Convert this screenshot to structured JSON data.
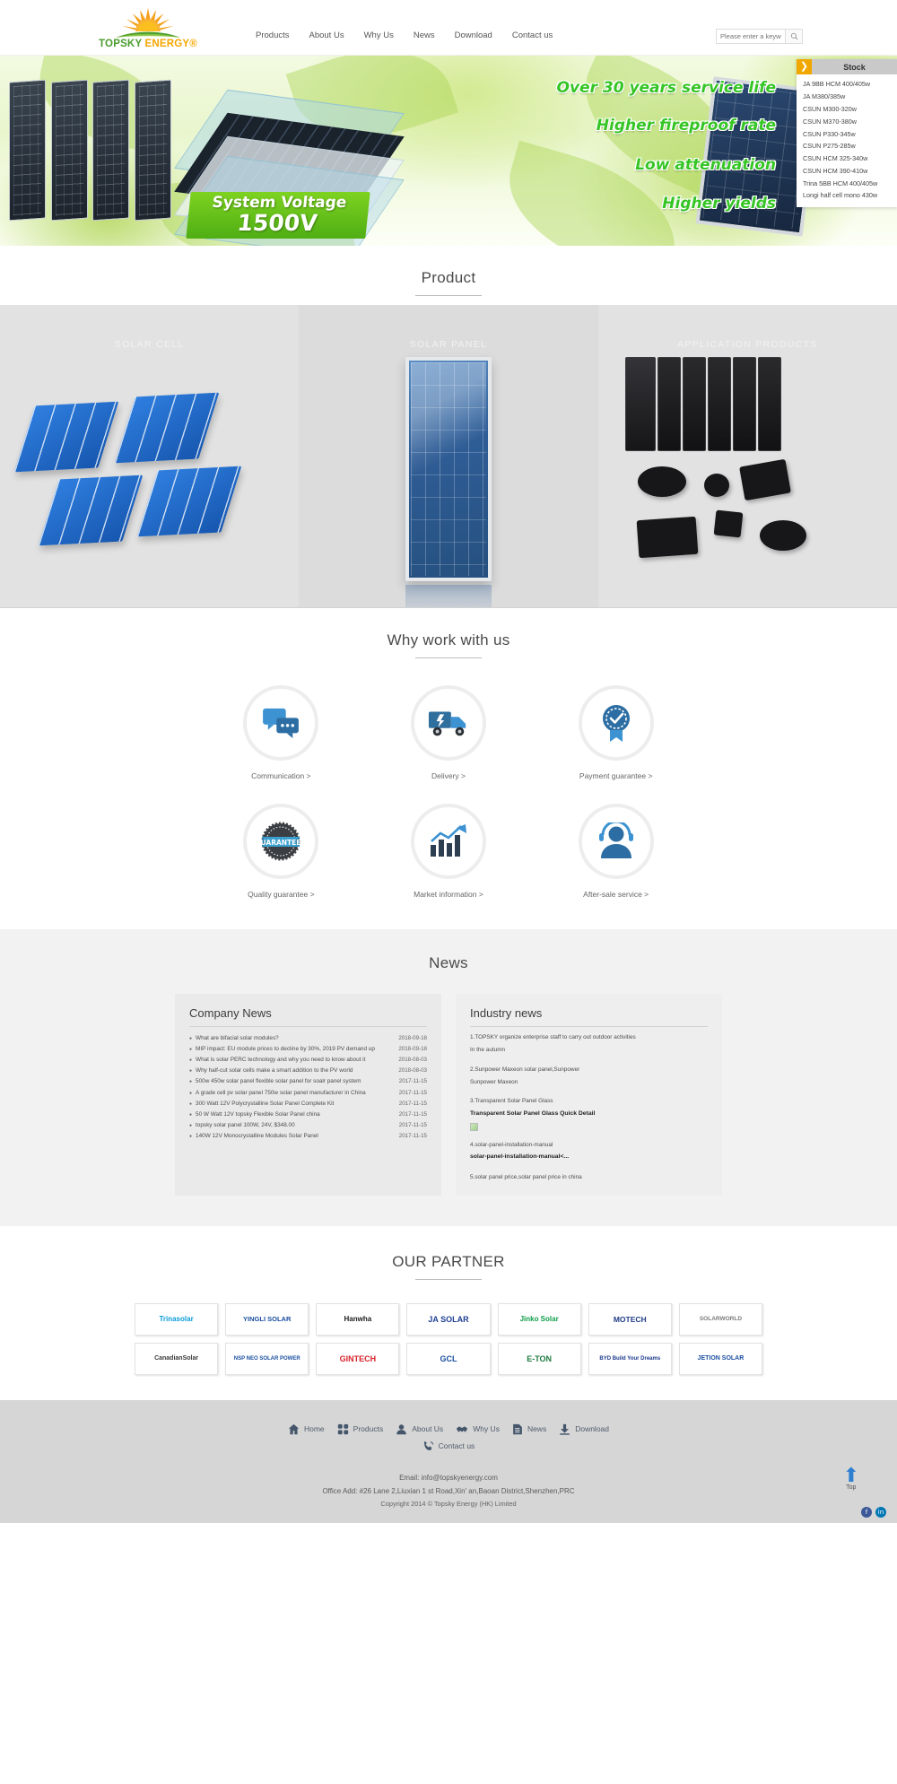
{
  "header": {
    "logo": {
      "name": "TOPSKY ENERGY®",
      "part1": "TOPSKY ",
      "part2": "ENERGY®"
    },
    "nav": [
      {
        "label": "Products"
      },
      {
        "label": "About Us"
      },
      {
        "label": "Why Us"
      },
      {
        "label": "News"
      },
      {
        "label": "Download"
      },
      {
        "label": "Contact us"
      }
    ],
    "search": {
      "placeholder": "Please enter a keyword",
      "value": "",
      "icon": "search-icon"
    }
  },
  "banner": {
    "lines": [
      "Over 30 years service life",
      "Higher fireproof rate",
      "Low attenuation",
      "Higher yields"
    ],
    "badge_line1": "System Voltage",
    "badge_line2": "1500V",
    "stock": {
      "arrow": "❯",
      "title": "Stock",
      "items": [
        "JA 9BB HCM 400/405w",
        "JA M380/385w",
        "CSUN M300-320w",
        "CSUN M370-380w",
        "CSUN P330-345w",
        "CSUN P275-285w",
        "CSUN HCM 325-340w",
        "CSUN HCM 390-410w",
        "Trina 5BB HCM 400/405w",
        "Longi half cell mono 430w"
      ]
    }
  },
  "product_section": {
    "title": "Product",
    "items": [
      {
        "label": "SOLAR CELL"
      },
      {
        "label": "SOLAR PANEL"
      },
      {
        "label": "APPLICATION PRODUCTS"
      }
    ]
  },
  "why_section": {
    "title": "Why work with us",
    "items": [
      {
        "label": "Communication >",
        "icon": "chat-bubbles-icon"
      },
      {
        "label": "Delivery >",
        "icon": "delivery-truck-icon"
      },
      {
        "label": "Payment guarantee >",
        "icon": "shield-check-badge-icon"
      },
      {
        "label": "Quality guarantee >",
        "icon": "guaranteed-seal-icon"
      },
      {
        "label": "Market information >",
        "icon": "bar-chart-arrow-icon"
      },
      {
        "label": "After-sale service >",
        "icon": "person-support-icon"
      }
    ]
  },
  "news_section": {
    "title": "News",
    "company": {
      "heading": "Company News",
      "items": [
        {
          "title": "What are bifacial solar modules?",
          "date": "2018-09-18"
        },
        {
          "title": "MIP impact: EU module prices to decline by 30%, 2019 PV demand up",
          "date": "2018-09-18"
        },
        {
          "title": "What is solar PERC technology and why you need to know about it",
          "date": "2018-08-03"
        },
        {
          "title": "Why half-cut solar cells make a smart addition to the PV world",
          "date": "2018-08-03"
        },
        {
          "title": "500w 450w solar panel flexible solar panel for soalr panel system",
          "date": "2017-11-15"
        },
        {
          "title": "A grade cell pv solar panel 750w solar panel manufacturer in China",
          "date": "2017-11-15"
        },
        {
          "title": "300 Watt 12V Polycrystalline Solar Panel Complete Kit",
          "date": "2017-11-15"
        },
        {
          "title": "50 W Watt 12V topsky Flexible Solar Panel china",
          "date": "2017-11-15"
        },
        {
          "title": "topsky solar panel 100W, 24V,  $348.00",
          "date": "2017-11-15"
        },
        {
          "title": "140W 12V Monocrystalline Modules Solar Panel",
          "date": "2017-11-15"
        }
      ]
    },
    "industry": {
      "heading": "Industry news",
      "lines": [
        "1.TOPSKY organize enterprise staff to carry out outdoor activities",
        "In the autumn",
        "2.Sunpower Maxeon solar panel,Sunpower",
        "Sunpower Maxeon",
        "3.Transparent Solar Panel Glass",
        "Transparent Solar Panel Glass Quick Detail",
        "4.solar-panel-installation-manual",
        "solar-panel-installation-manual<...",
        "5.solar panel price,solar panel price in china"
      ]
    }
  },
  "partners_section": {
    "title": "OUR PARTNER",
    "items": [
      {
        "name": "Trinasolar"
      },
      {
        "name": "YINGLI SOLAR"
      },
      {
        "name": "Hanwha"
      },
      {
        "name": "JA SOLAR"
      },
      {
        "name": "Jinko Solar"
      },
      {
        "name": "MOTECH"
      },
      {
        "name": "SOLARWORLD"
      },
      {
        "name": "CanadianSolar"
      },
      {
        "name": "NSP NEO SOLAR POWER"
      },
      {
        "name": "GINTECH"
      },
      {
        "name": "GCL"
      },
      {
        "name": "E-TON"
      },
      {
        "name": "BYD Build Your Dreams"
      },
      {
        "name": "JETION SOLAR"
      }
    ]
  },
  "footer": {
    "links": [
      {
        "label": "Home",
        "icon": "home-icon"
      },
      {
        "label": "Products",
        "icon": "grid-squares-icon"
      },
      {
        "label": "About Us",
        "icon": "person-icon"
      },
      {
        "label": "Why Us",
        "icon": "handshake-icon"
      },
      {
        "label": "News",
        "icon": "document-icon"
      },
      {
        "label": "Download",
        "icon": "download-icon"
      },
      {
        "label": "Contact us",
        "icon": "phone-icon"
      }
    ],
    "email": "Email: info@topskyenergy.com",
    "address": "Office Add: #26 Lane 2,Liuxian 1 st Road,Xin' an,Baoan District,Shenzhen,PRC",
    "copyright": "Copyright 2014 © Topsky Energy (HK) Limited",
    "to_top": {
      "label": "Top",
      "icon": "up-arrow-icon"
    },
    "social": [
      {
        "name": "facebook-icon",
        "glyph": "f"
      },
      {
        "name": "linkedin-icon",
        "glyph": "in"
      }
    ]
  },
  "colors": {
    "brand_orange": "#f7a600",
    "brand_green": "#4a9c2d",
    "banner_green_text": "#35c524",
    "accent_blue": "#2f7fd1",
    "stock_header": "#c9c9c9",
    "stock_arrow": "#f0a800"
  }
}
